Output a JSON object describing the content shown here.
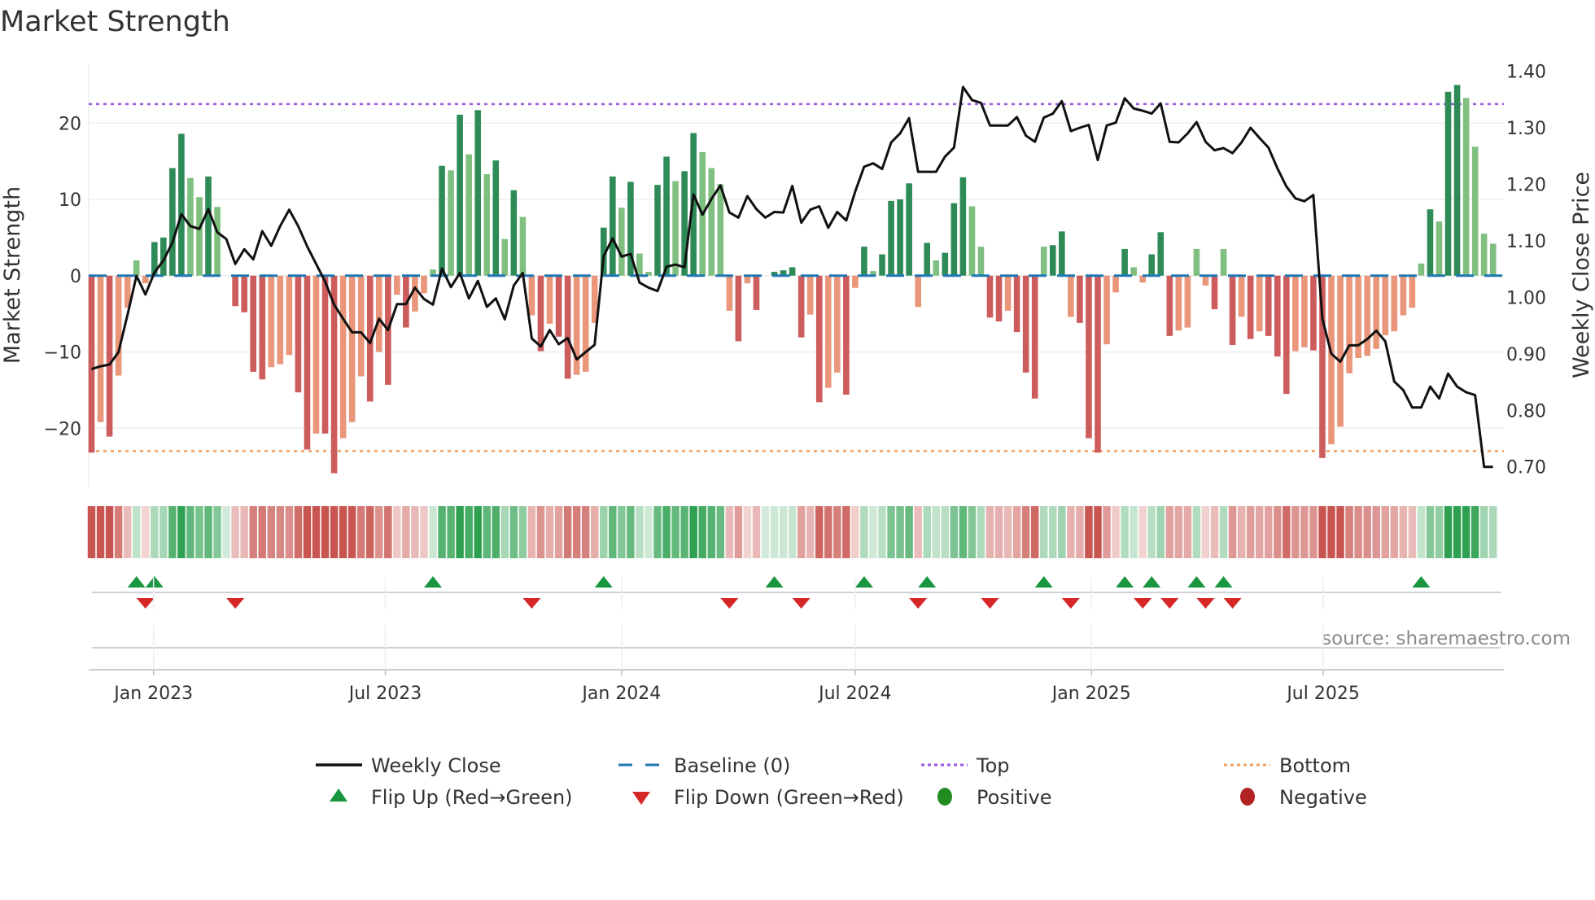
{
  "chart_data": {
    "type": "bar",
    "title": "Market Strength",
    "ylabel": "Market Strength",
    "y2label": "Weekly Close Price",
    "ylim": [
      -27,
      27
    ],
    "y2lim": [
      0.7,
      1.4
    ],
    "yticks": [
      {
        "v": 20,
        "label": "20"
      },
      {
        "v": 10,
        "label": "10"
      },
      {
        "v": 0,
        "label": "0"
      },
      {
        "v": -10,
        "label": "−10"
      },
      {
        "v": -20,
        "label": "−20"
      }
    ],
    "y2ticks": [
      {
        "v": 1.4,
        "label": "1.40"
      },
      {
        "v": 1.3,
        "label": "1.30"
      },
      {
        "v": 1.2,
        "label": "1.20"
      },
      {
        "v": 1.1,
        "label": "1.10"
      },
      {
        "v": 1.0,
        "label": "1.00"
      },
      {
        "v": 0.9,
        "label": "0.90"
      },
      {
        "v": 0.8,
        "label": "0.80"
      },
      {
        "v": 0.7,
        "label": "0.70"
      }
    ],
    "x_unit": "week index",
    "x_ticks": [
      {
        "week": 6.9,
        "label": "Jan 2023"
      },
      {
        "week": 32.7,
        "label": "Jul 2023"
      },
      {
        "week": 59.0,
        "label": "Jan 2024"
      },
      {
        "week": 85.0,
        "label": "Jul 2024"
      },
      {
        "week": 111.3,
        "label": "Jan 2025"
      },
      {
        "week": 137.1,
        "label": "Jul 2025"
      }
    ],
    "top_level": 22.5,
    "bottom_level": -23.0,
    "baseline": 0,
    "strength": [
      -23.2,
      -19.2,
      -21.1,
      -13.1,
      -4.2,
      2.0,
      -1.0,
      4.4,
      5.0,
      14.1,
      18.6,
      12.8,
      10.3,
      13.0,
      9.0,
      0,
      -4.0,
      -4.8,
      -12.6,
      -13.6,
      -12.0,
      -11.6,
      -10.4,
      -15.3,
      -22.8,
      -20.7,
      -20.7,
      -25.9,
      -21.3,
      -19.2,
      -13.2,
      -16.5,
      -10.0,
      -14.3,
      -2.5,
      -6.8,
      -4.7,
      -2.3,
      0.8,
      14.4,
      13.8,
      21.1,
      15.9,
      21.7,
      13.3,
      15.1,
      4.8,
      11.2,
      7.7,
      -5.2,
      -9.9,
      -6.3,
      -8.0,
      -13.5,
      -13.0,
      -12.6,
      -6.2,
      6.3,
      13.0,
      8.9,
      12.3,
      2.9,
      0.5,
      11.9,
      15.6,
      12.4,
      13.7,
      18.7,
      16.2,
      14.1,
      12.0,
      -4.6,
      -8.6,
      -1.0,
      -4.5,
      0,
      0.5,
      0.7,
      1.1,
      -8.1,
      -5.1,
      -16.6,
      -14.7,
      -12.7,
      -15.6,
      -1.6,
      3.8,
      0.6,
      2.8,
      9.8,
      10.0,
      12.1,
      -4.1,
      4.3,
      2.0,
      3.0,
      9.5,
      12.9,
      9.1,
      3.8,
      -5.5,
      -6.0,
      -4.6,
      -7.4,
      -12.7,
      -16.1,
      3.8,
      4.0,
      5.8,
      -5.4,
      -6.2,
      -21.3,
      -23.2,
      -9.0,
      -2.2,
      3.5,
      1.1,
      -0.9,
      2.8,
      5.7,
      -7.9,
      -7.2,
      -6.8,
      3.5,
      -1.3,
      -4.4,
      3.5,
      -9.1,
      -5.4,
      -8.3,
      -7.3,
      -7.9,
      -10.6,
      -15.5,
      -9.9,
      -9.4,
      -9.8,
      -23.9,
      -22.1,
      -19.8,
      -12.8,
      -10.8,
      -10.5,
      -9.6,
      -7.8,
      -7.3,
      -5.2,
      -4.2,
      1.6,
      8.7,
      7.1,
      24.1,
      25.0,
      23.3,
      16.9,
      5.5,
      4.2
    ],
    "weekly_close": [
      0.873,
      0.878,
      0.881,
      0.903,
      0.969,
      1.038,
      1.005,
      1.044,
      1.065,
      1.097,
      1.147,
      1.126,
      1.121,
      1.156,
      1.115,
      1.103,
      1.059,
      1.085,
      1.067,
      1.117,
      1.091,
      1.126,
      1.155,
      1.126,
      1.09,
      1.059,
      1.028,
      0.987,
      0.962,
      0.938,
      0.938,
      0.919,
      0.962,
      0.942,
      0.988,
      0.988,
      1.017,
      0.997,
      0.987,
      1.051,
      1.018,
      1.043,
      0.998,
      1.029,
      0.983,
      0.998,
      0.961,
      1.021,
      1.043,
      0.927,
      0.913,
      0.942,
      0.917,
      0.928,
      0.89,
      0.903,
      0.916,
      1.073,
      1.104,
      1.072,
      1.077,
      1.026,
      1.017,
      1.011,
      1.054,
      1.058,
      1.053,
      1.182,
      1.146,
      1.174,
      1.198,
      1.15,
      1.141,
      1.179,
      1.156,
      1.141,
      1.151,
      1.15,
      1.197,
      1.132,
      1.155,
      1.161,
      1.123,
      1.151,
      1.136,
      1.187,
      1.231,
      1.237,
      1.227,
      1.274,
      1.29,
      1.317,
      1.222,
      1.222,
      1.222,
      1.249,
      1.265,
      1.372,
      1.349,
      1.344,
      1.304,
      1.304,
      1.304,
      1.319,
      1.286,
      1.275,
      1.318,
      1.325,
      1.347,
      1.294,
      1.3,
      1.305,
      1.243,
      1.304,
      1.309,
      1.352,
      1.334,
      1.33,
      1.325,
      1.343,
      1.275,
      1.274,
      1.29,
      1.31,
      1.275,
      1.26,
      1.264,
      1.255,
      1.274,
      1.3,
      1.282,
      1.265,
      1.228,
      1.196,
      1.175,
      1.17,
      1.181,
      0.962,
      0.9,
      0.886,
      0.915,
      0.915,
      0.926,
      0.941,
      0.922,
      0.851,
      0.836,
      0.805,
      0.805,
      0.842,
      0.821,
      0.865,
      0.842,
      0.832,
      0.827,
      0.7,
      0.7
    ],
    "flip_up_weeks": [
      5,
      7,
      38,
      57,
      76,
      86,
      93,
      106,
      115,
      118,
      123,
      126,
      148
    ],
    "flip_down_weeks": [
      6,
      16,
      49,
      71,
      79,
      92,
      100,
      109,
      117,
      120,
      124,
      127
    ],
    "legend": {
      "placement": "bottom-center",
      "items": [
        {
          "key": "line",
          "label": "Weekly Close"
        },
        {
          "key": "baseline",
          "label": "Baseline (0)"
        },
        {
          "key": "top",
          "label": "Top"
        },
        {
          "key": "bottom",
          "label": "Bottom"
        },
        {
          "key": "flip_up",
          "label": "Flip Up (Red→Green)"
        },
        {
          "key": "flip_down",
          "label": "Flip Down (Green→Red)"
        },
        {
          "key": "positive",
          "label": "Positive"
        },
        {
          "key": "negative",
          "label": "Negative"
        }
      ]
    },
    "source": "source: sharemaestro.com"
  },
  "colors": {
    "pos_strong": "#2e8b57",
    "pos_weak": "#7fbf7f",
    "neg_strong": "#cd5c5c",
    "neg_weak": "#e9967a",
    "line": "#111111",
    "baseline": "#1f77b4",
    "top": "#9b59e0",
    "bottom": "#f0a060",
    "flip_up": "#1a9641",
    "flip_down": "#d62728",
    "positive": "#228b22",
    "negative": "#b22222"
  }
}
